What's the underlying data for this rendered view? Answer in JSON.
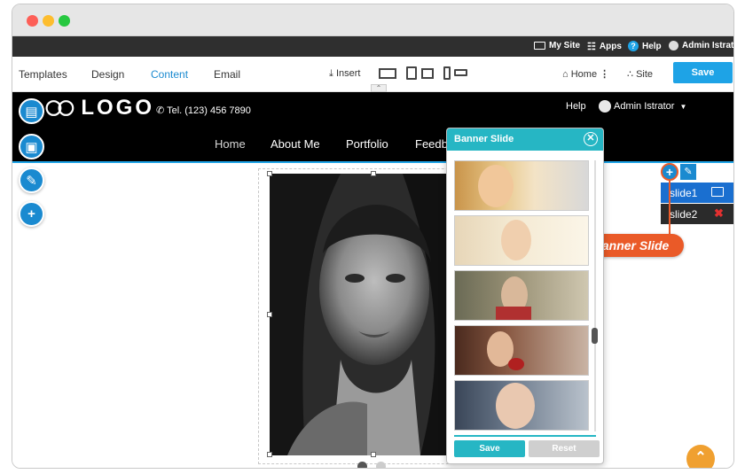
{
  "admin_bar": {
    "my_site": "My Site",
    "apps": "Apps",
    "help": "Help",
    "user": "Admin Istrator"
  },
  "toolbar": {
    "tabs": [
      "Templates",
      "Design",
      "Content",
      "Email"
    ],
    "active_tab": "Content",
    "insert": "Insert",
    "home": "Home",
    "site": "Site",
    "save": "Save"
  },
  "site": {
    "logo": "LOGO",
    "phone": "Tel. (123) 456 7890",
    "help": "Help",
    "user": "Admin Istrator",
    "nav": [
      "Home",
      "About Me",
      "Portfolio",
      "Feedb"
    ]
  },
  "banner_panel": {
    "title": "Banner Slide",
    "save": "Save",
    "reset": "Reset",
    "thumbnails": [
      "portrait-blonde",
      "portrait-flowers",
      "portrait-dark",
      "portrait-red",
      "portrait-close"
    ]
  },
  "slides": [
    {
      "label": "slide1",
      "icon": "image-icon"
    },
    {
      "label": "slide2",
      "icon": "delete-icon"
    }
  ],
  "callout": "Add Banner Slide",
  "colors": {
    "accent": "#1ea3e6",
    "panel": "#26b6c4",
    "callout": "#ea5a28",
    "side_button": "#1a8ad0",
    "scroll_top": "#f0a030"
  }
}
